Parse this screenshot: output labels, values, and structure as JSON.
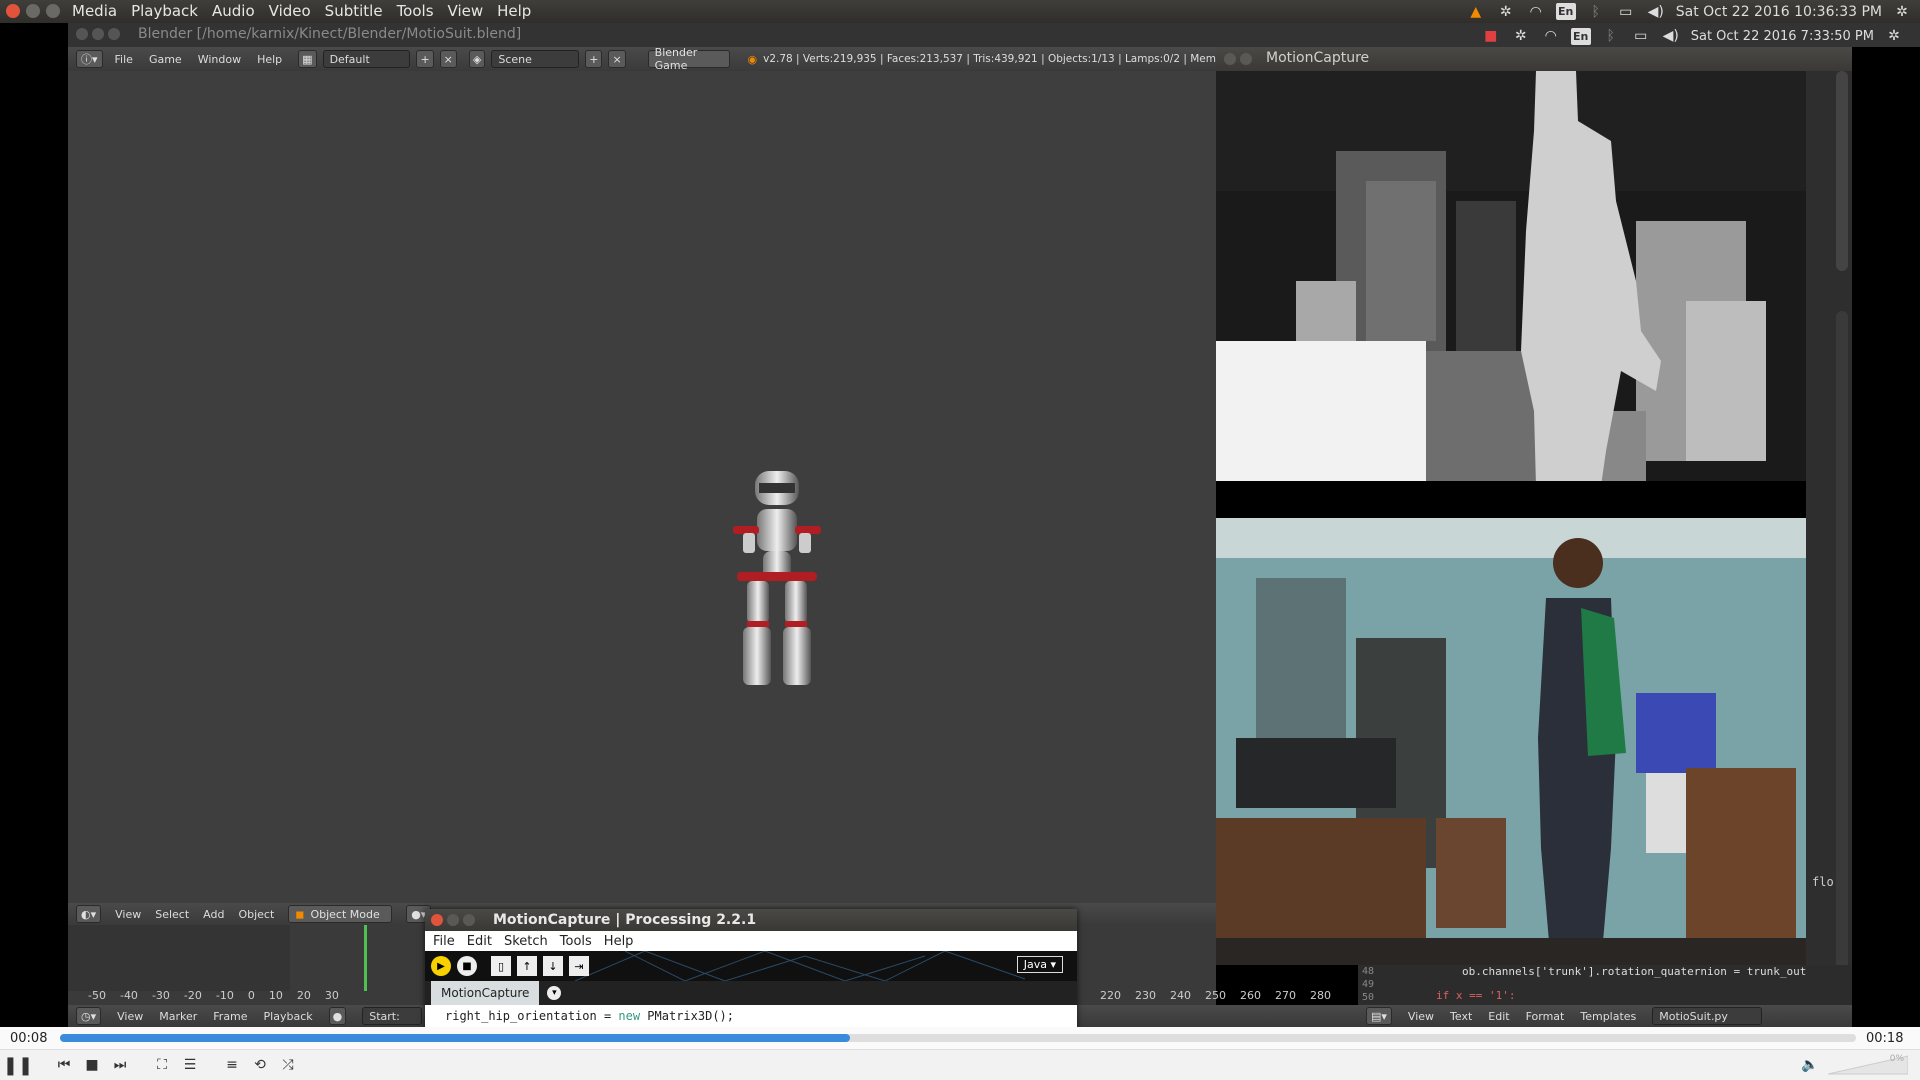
{
  "vlc": {
    "menu": [
      "Media",
      "Playback",
      "Audio",
      "Video",
      "Subtitle",
      "Tools",
      "View",
      "Help"
    ],
    "tray": {
      "lang": "En",
      "datetime": "Sat Oct 22 2016 10:36:33 PM"
    },
    "time_elapsed": "00:08",
    "time_total": "00:18",
    "progress": 0.44,
    "volume_label": "0%"
  },
  "inner_desktop": {
    "window_title": "Blender [/home/karnix/Kinect/Blender/MotioSuit.blend]",
    "tray": {
      "lang": "En",
      "datetime": "Sat Oct 22 2016 7:33:50 PM"
    }
  },
  "blender": {
    "menu": [
      "File",
      "Game",
      "Window",
      "Help"
    ],
    "layout": "Default",
    "scene": "Scene",
    "engine": "Blender Game",
    "stats": "v2.78 | Verts:219,935 | Faces:213,537 | Tris:439,921 | Objects:1/13 | Lamps:0/2 | Mem",
    "view3d_menu": [
      "View",
      "Select",
      "Add",
      "Object"
    ],
    "mode": "Object Mode",
    "timeline_ticks": [
      "-50",
      "-40",
      "-30",
      "-20",
      "-10",
      "0",
      "10",
      "20",
      "30"
    ],
    "timeline_ticks_right": [
      "220",
      "230",
      "240",
      "250",
      "260",
      "270",
      "280"
    ],
    "timeline_menu": [
      "View",
      "Marker",
      "Frame",
      "Playback"
    ],
    "start_label": "Start:"
  },
  "motioncapture": {
    "title": "MotionCapture"
  },
  "processing": {
    "title": "MotionCapture | Processing 2.2.1",
    "menu": [
      "File",
      "Edit",
      "Sketch",
      "Tools",
      "Help"
    ],
    "mode": "Java",
    "tab": "MotionCapture",
    "code_line_prefix": "right_hip_orientation = ",
    "code_keyword": "new",
    "code_line_suffix": " PMatrix3D();"
  },
  "text_editor": {
    "line_numbers": [
      "48",
      "49",
      "50"
    ],
    "line1": "ob.channels['trunk'].rotation_quaternion = trunk_out",
    "line2": "if x == '1':",
    "side_text": "flo",
    "menu": [
      "View",
      "Text",
      "Edit",
      "Format",
      "Templates"
    ],
    "filename": "MotioSuit.py"
  },
  "colors": {
    "accent": "#3b8bdc",
    "vlc_orange": "#f08a00",
    "play_yellow": "#f7d200"
  }
}
